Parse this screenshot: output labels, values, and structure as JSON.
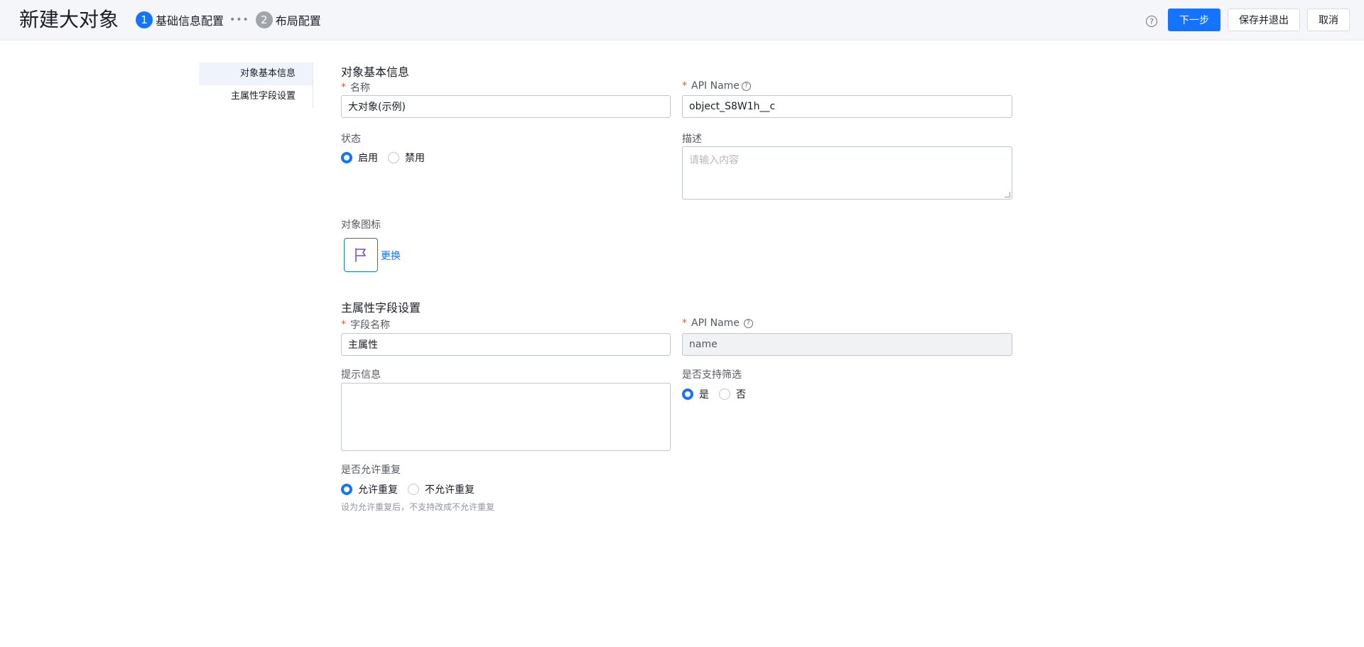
{
  "header": {
    "title": "新建大对象",
    "steps": [
      {
        "num": "1",
        "label": "基础信息配置"
      },
      {
        "num": "2",
        "label": "布局配置"
      }
    ],
    "step_dots": "•••",
    "help": "?",
    "buttons": {
      "next": "下一步",
      "save_exit": "保存并退出",
      "cancel": "取消"
    }
  },
  "sidebar": {
    "items": [
      {
        "label": "对象基本信息"
      },
      {
        "label": "主属性字段设置"
      }
    ]
  },
  "basic": {
    "section_title": "对象基本信息",
    "name_label": "名称",
    "name_value": "大对象(示例)",
    "api_label": "API Name",
    "api_value": "object_S8W1h__c",
    "status_label": "状态",
    "status_options": [
      "启用",
      "禁用"
    ],
    "desc_label": "描述",
    "desc_placeholder": "请输入内容",
    "icon_label": "对象图标",
    "change_link": "更换"
  },
  "main_field": {
    "section_title": "主属性字段设置",
    "field_name_label": "字段名称",
    "field_name_value": "主属性",
    "api_label": "API Name",
    "api_value": "name",
    "tip_label": "提示信息",
    "filter_label": "是否支持筛选",
    "filter_options": [
      "是",
      "否"
    ],
    "dup_label": "是否允许重复",
    "dup_options": [
      "允许重复",
      "不允许重复"
    ],
    "dup_hint": "设为允许重复后，不支持改成不允许重复"
  },
  "colors": {
    "primary": "#1473ff",
    "required": "#ff522a",
    "icon": "#6e4fd8"
  },
  "required_mark": "*",
  "question_mark": "?"
}
